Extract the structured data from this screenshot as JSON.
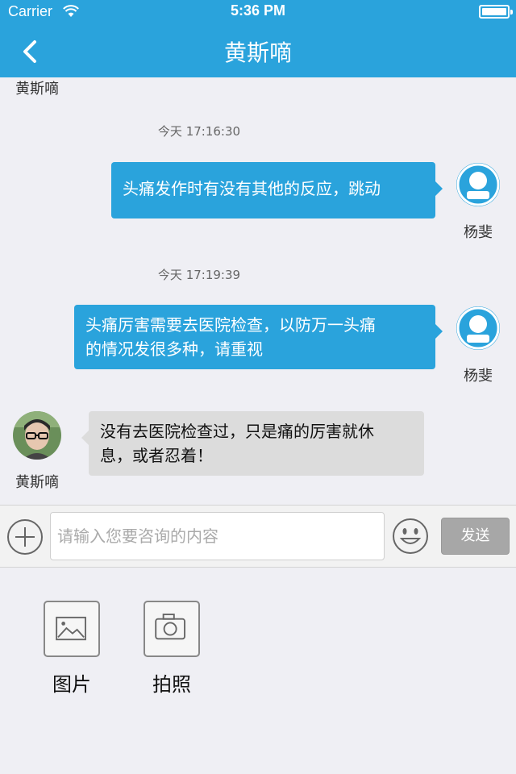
{
  "status_bar": {
    "carrier": "Carrier",
    "time": "5:36 PM"
  },
  "nav": {
    "title": "黄斯嘀"
  },
  "chat": {
    "partial_top_name": "黄斯嘀",
    "messages": [
      {
        "timestamp": "今天 17:16:30",
        "text": "头痛发作时有没有其他的反应，跳动",
        "sender": "杨斐"
      },
      {
        "timestamp": "今天 17:19:39",
        "line1": "头痛厉害需要去医院检查，以防万一头痛",
        "line2": "的情况发很多种，请重视",
        "sender": "杨斐"
      },
      {
        "line1": "没有去医院检查过，只是痛的厉害就休",
        "line2": "息，或者忍着！",
        "sender": "黄斯嘀"
      }
    ]
  },
  "input": {
    "placeholder": "请输入您要咨询的内容",
    "send_label": "发送"
  },
  "tools": [
    {
      "label": "图片",
      "icon": "image-icon"
    },
    {
      "label": "拍照",
      "icon": "camera-icon"
    }
  ],
  "colors": {
    "accent": "#2aa3dc",
    "background": "#efeff4",
    "incoming_bubble": "#dcdcdc",
    "send_button": "#a7a7a7"
  }
}
